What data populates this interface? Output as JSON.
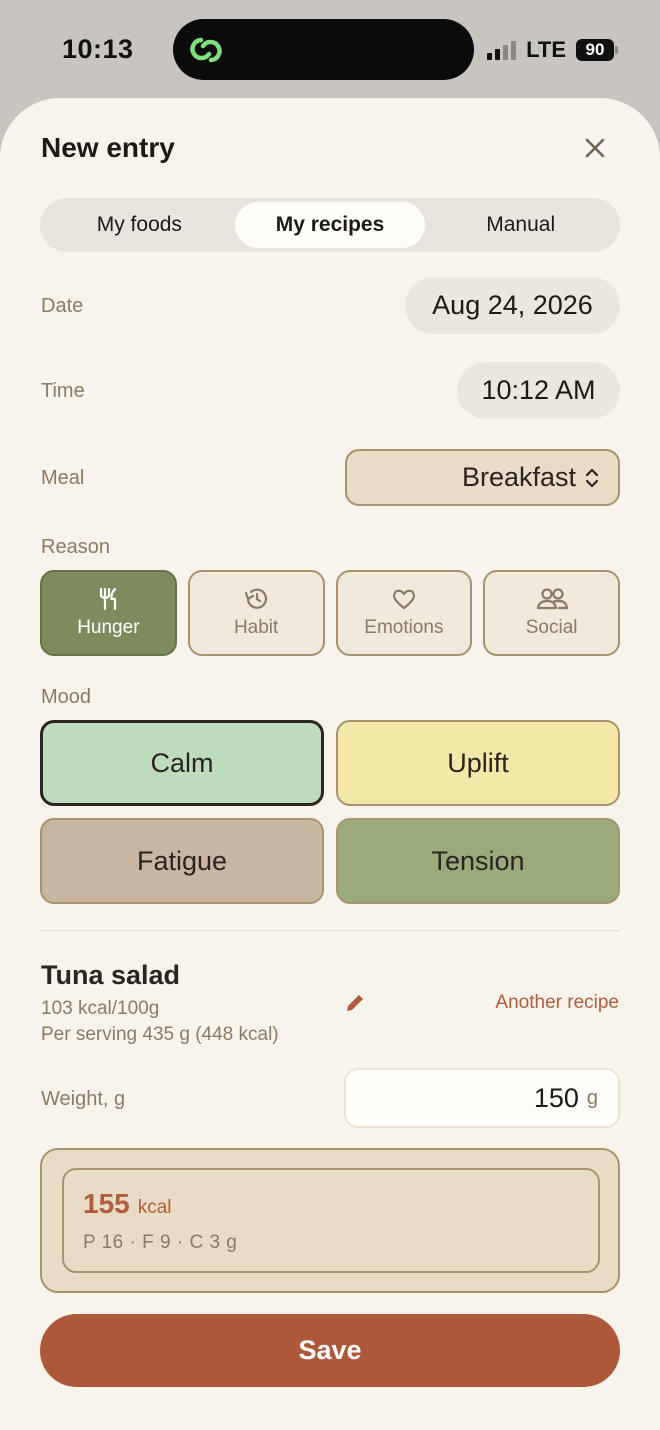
{
  "status_bar": {
    "time": "10:13",
    "network": "LTE",
    "battery": "90"
  },
  "header": {
    "title": "New entry"
  },
  "tabs": [
    {
      "label": "My foods",
      "active": false
    },
    {
      "label": "My recipes",
      "active": true
    },
    {
      "label": "Manual",
      "active": false
    }
  ],
  "date": {
    "label": "Date",
    "value": "Aug 24, 2026"
  },
  "time": {
    "label": "Time",
    "value": "10:12 AM"
  },
  "meal": {
    "label": "Meal",
    "value": "Breakfast"
  },
  "reason": {
    "label": "Reason",
    "items": [
      {
        "label": "Hunger",
        "icon": "fork-knife-icon",
        "active": true
      },
      {
        "label": "Habit",
        "icon": "history-icon",
        "active": false
      },
      {
        "label": "Emotions",
        "icon": "heart-icon",
        "active": false
      },
      {
        "label": "Social",
        "icon": "people-icon",
        "active": false
      }
    ]
  },
  "mood": {
    "label": "Mood",
    "items": [
      {
        "label": "Calm",
        "color": "#bcdcbc",
        "selected": true
      },
      {
        "label": "Uplift",
        "color": "#f4e8a8",
        "selected": false
      },
      {
        "label": "Fatigue",
        "color": "#c9b6a0",
        "selected": false
      },
      {
        "label": "Tension",
        "color": "#99ab7c",
        "selected": false
      }
    ]
  },
  "recipe": {
    "name": "Tuna salad",
    "density": "103 kcal/100g",
    "serving": "Per serving 435 g (448 kcal)",
    "another_label": "Another recipe"
  },
  "weight": {
    "label": "Weight, g",
    "value": "150",
    "unit": "g"
  },
  "summary": {
    "kcal": "155",
    "kcal_unit": "kcal",
    "macros": "P 16 · F 9 · C 3 g"
  },
  "save_label": "Save",
  "colors": {
    "accent": "#ad5838",
    "olive": "#7d8b5e",
    "sheet_bg": "#f8f4ec"
  }
}
